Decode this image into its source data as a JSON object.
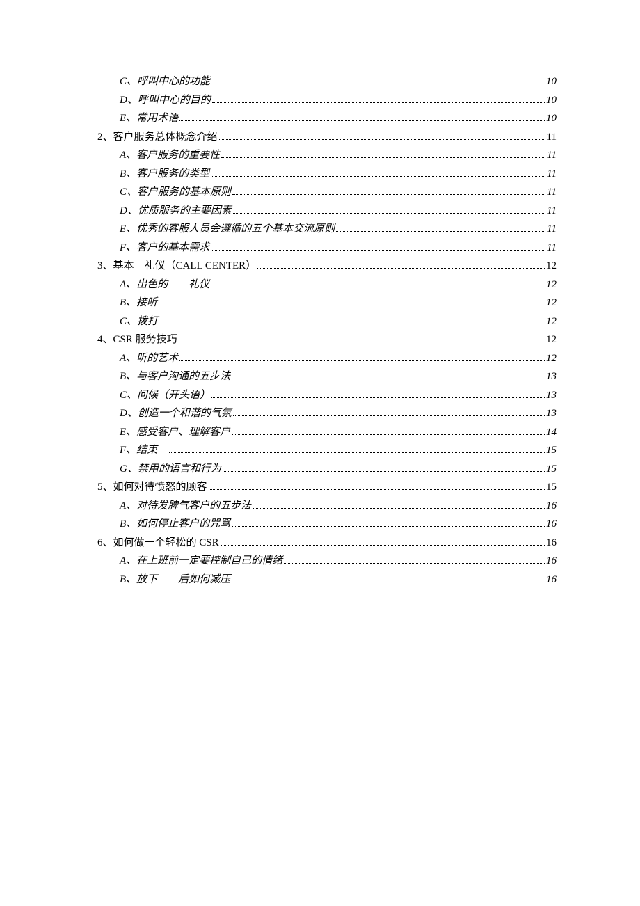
{
  "toc": [
    {
      "level": 2,
      "label": "C、呼叫中心的功能",
      "page": "10"
    },
    {
      "level": 2,
      "label": "D、呼叫中心的目的",
      "page": "10"
    },
    {
      "level": 2,
      "label": "E、常用术语",
      "page": "10"
    },
    {
      "level": 1,
      "label": "2、客户服务总体概念介绍 ",
      "page": "11"
    },
    {
      "level": 2,
      "label": "A、客户服务的重要性",
      "page": "11"
    },
    {
      "level": 2,
      "label": "B、客户服务的类型",
      "page": "11"
    },
    {
      "level": 2,
      "label": "C、客户服务的基本原则",
      "page": "11"
    },
    {
      "level": 2,
      "label": "D、优质服务的主要因素",
      "page": "11"
    },
    {
      "level": 2,
      "label": "E、优秀的客服人员会遵循的五个基本交流原则",
      "page": "11"
    },
    {
      "level": 2,
      "label": "F、客户的基本需求",
      "page": "11"
    },
    {
      "level": 1,
      "label": "3、基本　礼仪（CALL CENTER） ",
      "page": "12",
      "smallcaps": true
    },
    {
      "level": 2,
      "label": "A、出色的　　礼仪",
      "page": "12"
    },
    {
      "level": 2,
      "label": "B、接听　",
      "page": "12"
    },
    {
      "level": 2,
      "label": "C、拨打　",
      "page": "12"
    },
    {
      "level": 1,
      "label": "4、CSR 服务技巧 ",
      "page": "12"
    },
    {
      "level": 2,
      "label": "A、听的艺术",
      "page": "12"
    },
    {
      "level": 2,
      "label": "B、与客户沟通的五步法",
      "page": "13"
    },
    {
      "level": 2,
      "label": "C、问候（开头语） ",
      "page": "13"
    },
    {
      "level": 2,
      "label": "D、创造一个和谐的气氛",
      "page": "13"
    },
    {
      "level": 2,
      "label": "E、感受客户、理解客户",
      "page": "14"
    },
    {
      "level": 2,
      "label": "F、结束　",
      "page": "15"
    },
    {
      "level": 2,
      "label": "G、禁用的语言和行为",
      "page": "15"
    },
    {
      "level": 1,
      "label": "5、如何对待愤怒的顾客 ",
      "page": "15"
    },
    {
      "level": 2,
      "label": "A、对待发脾气客户的五步法",
      "page": "16"
    },
    {
      "level": 2,
      "label": "B、如何停止客户的咒骂",
      "page": "16"
    },
    {
      "level": 1,
      "label": "6、如何做一个轻松的 CSR ",
      "page": "16"
    },
    {
      "level": 2,
      "label": "A、在上班前一定要控制自己的情绪",
      "page": "16"
    },
    {
      "level": 2,
      "label": "B、放下　　后如何减压",
      "page": "16"
    }
  ]
}
